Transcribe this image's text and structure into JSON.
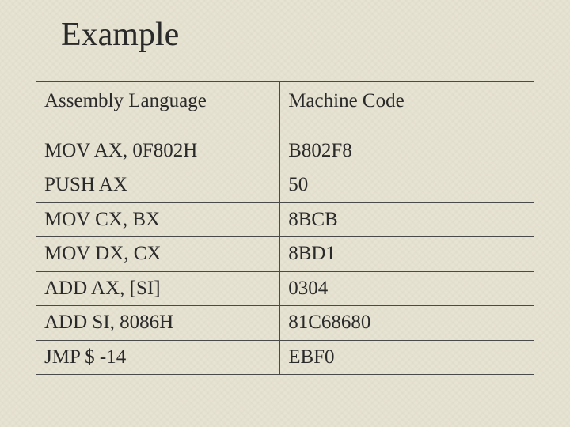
{
  "title": "Example",
  "table": {
    "headers": {
      "col1": "Assembly Language",
      "col2": "Machine Code"
    },
    "rows": [
      {
        "assembly": "MOV AX, 0F802H",
        "machine": "B802F8"
      },
      {
        "assembly": "PUSH AX",
        "machine": "50"
      },
      {
        "assembly": "MOV CX, BX",
        "machine": "8BCB"
      },
      {
        "assembly": "MOV DX, CX",
        "machine": "8BD1"
      },
      {
        "assembly": "ADD AX, [SI]",
        "machine": "0304"
      },
      {
        "assembly": "ADD SI, 8086H",
        "machine": "81C68680"
      },
      {
        "assembly": "JMP $ -14",
        "machine": "EBF0"
      }
    ]
  }
}
